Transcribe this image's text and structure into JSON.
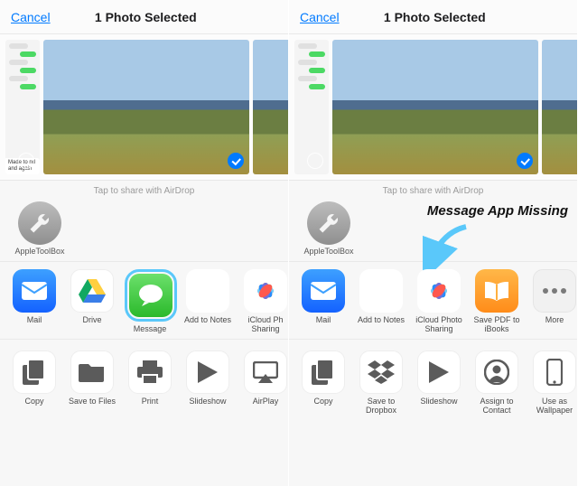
{
  "left": {
    "header": {
      "cancel": "Cancel",
      "title": "1 Photo Selected"
    },
    "airdrop_caption": "Tap to share with AirDrop",
    "airdrop_contact": "AppleToolBox",
    "small_thumb_tag": "Made to\nnd and\nagain",
    "apps": [
      {
        "key": "mail",
        "label": "Mail"
      },
      {
        "key": "drive",
        "label": "Drive"
      },
      {
        "key": "message",
        "label": "Message",
        "highlight": true
      },
      {
        "key": "notes",
        "label": "Add to Notes"
      },
      {
        "key": "photos",
        "label": "iCloud Ph\nSharing"
      }
    ],
    "actions": [
      {
        "key": "copy",
        "label": "Copy"
      },
      {
        "key": "files",
        "label": "Save to Files"
      },
      {
        "key": "print",
        "label": "Print"
      },
      {
        "key": "slides",
        "label": "Slideshow"
      },
      {
        "key": "airplay",
        "label": "AirPlay"
      }
    ]
  },
  "right": {
    "header": {
      "cancel": "Cancel",
      "title": "1 Photo Selected"
    },
    "airdrop_caption": "Tap to share with AirDrop",
    "airdrop_contact": "AppleToolBox",
    "annotation_text": "Message App Missing",
    "apps": [
      {
        "key": "mail",
        "label": "Mail"
      },
      {
        "key": "notes",
        "label": "Add to Notes"
      },
      {
        "key": "photos",
        "label": "iCloud Photo\nSharing"
      },
      {
        "key": "ibooks",
        "label": "Save PDF\nto iBooks"
      },
      {
        "key": "more",
        "label": "More"
      }
    ],
    "actions": [
      {
        "key": "copy",
        "label": "Copy"
      },
      {
        "key": "dropbox",
        "label": "Save to\nDropbox"
      },
      {
        "key": "slides",
        "label": "Slideshow"
      },
      {
        "key": "contact",
        "label": "Assign\nto Contact"
      },
      {
        "key": "wall",
        "label": "Use as\nWallpaper"
      }
    ]
  },
  "colors": {
    "accent": "#007aff",
    "highlight": "#5ac8fa"
  }
}
